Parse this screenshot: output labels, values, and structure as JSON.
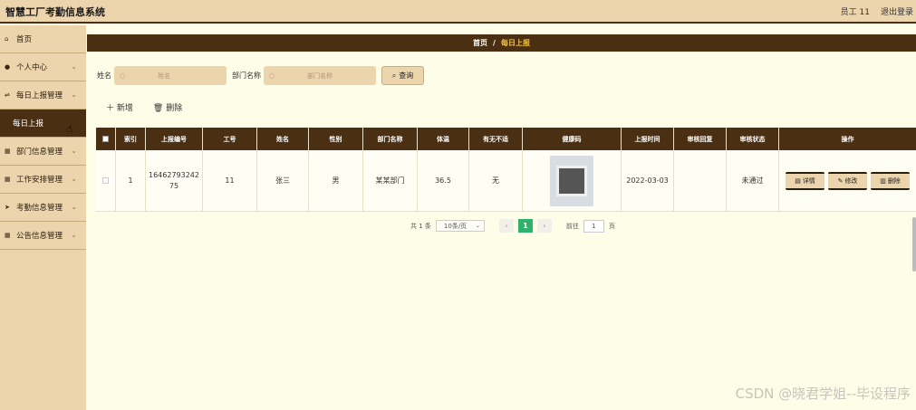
{
  "app": {
    "title": "智慧工厂考勤信息系统",
    "user": "员工 11",
    "logout": "退出登录"
  },
  "sidebar": {
    "items": [
      {
        "label": "首页",
        "icon": "home-icon"
      },
      {
        "label": "个人中心",
        "icon": "user-icon"
      },
      {
        "label": "每日上报管理",
        "icon": "sort-icon"
      },
      {
        "label": "每日上报",
        "icon": ""
      },
      {
        "label": "部门信息管理",
        "icon": "grid-icon"
      },
      {
        "label": "工作安排管理",
        "icon": "grid-icon"
      },
      {
        "label": "考勤信息管理",
        "icon": "send-icon"
      },
      {
        "label": "公告信息管理",
        "icon": "grid-icon"
      }
    ]
  },
  "breadcrumb": {
    "home": "首页",
    "sep": "/",
    "current": "每日上报"
  },
  "search": {
    "name_label": "姓名",
    "name_placeholder": "姓名",
    "dept_label": "部门名称",
    "dept_placeholder": "部门名称",
    "button": "查询"
  },
  "actions": {
    "add": "新增",
    "delete": "删除"
  },
  "table": {
    "headers": [
      "索引",
      "上报编号",
      "工号",
      "姓名",
      "性别",
      "部门名称",
      "体温",
      "有无不适",
      "健康码",
      "上报时间",
      "审核回复",
      "审核状态",
      "操作"
    ],
    "rows": [
      {
        "index": "1",
        "report_no_line1": "16462793242",
        "report_no_line2": "75",
        "emp_no": "11",
        "name": "张三",
        "gender": "男",
        "dept": "某某部门",
        "temp": "36.5",
        "discomfort": "无",
        "report_time": "2022-03-03",
        "reply": "",
        "status": "未通过"
      }
    ],
    "row_actions": {
      "detail": "详情",
      "edit": "修改",
      "delete": "删除"
    }
  },
  "pagination": {
    "total": "共 1 条",
    "page_size": "10条/页",
    "current": "1",
    "goto_label": "前往",
    "goto_value": "1",
    "page_unit": "页"
  },
  "watermark": "CSDN @晓君学姐--毕设程序",
  "colors": {
    "primary": "#4a2f12",
    "panel": "#ecd5ad",
    "background": "#fefde8",
    "active_page": "#2fb36b"
  }
}
